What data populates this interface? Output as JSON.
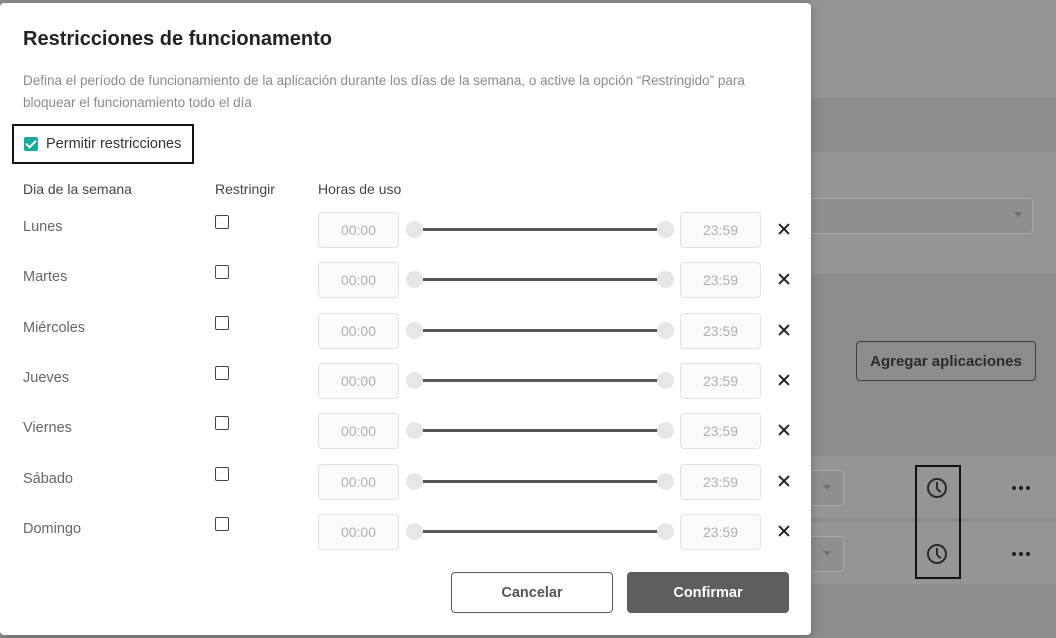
{
  "background": {
    "add_apps_button": "Agregar aplicaciones",
    "rows": [
      {
        "clock_icon": "clock-icon",
        "more_icon": "more-dots-icon"
      },
      {
        "clock_icon": "clock-icon",
        "more_icon": "more-dots-icon"
      }
    ]
  },
  "modal": {
    "title": "Restricciones de funcionamento",
    "description": "Defina el período de funcionamiento de la aplicación durante los días de la semana, o active la opción “Restringido” para bloquear el funcionamiento todo el día",
    "allow_restrictions": {
      "label": "Permitir restricciones",
      "checked": true
    },
    "columns": {
      "day": "Dia de la semana",
      "restrict": "Restringir",
      "hours": "Horas de uso"
    },
    "days": [
      {
        "name": "Lunes",
        "restricted": false,
        "start": "00:00",
        "end": "23:59"
      },
      {
        "name": "Martes",
        "restricted": false,
        "start": "00:00",
        "end": "23:59"
      },
      {
        "name": "Miércoles",
        "restricted": false,
        "start": "00:00",
        "end": "23:59"
      },
      {
        "name": "Jueves",
        "restricted": false,
        "start": "00:00",
        "end": "23:59"
      },
      {
        "name": "Viernes",
        "restricted": false,
        "start": "00:00",
        "end": "23:59"
      },
      {
        "name": "Sábado",
        "restricted": false,
        "start": "00:00",
        "end": "23:59"
      },
      {
        "name": "Domingo",
        "restricted": false,
        "start": "00:00",
        "end": "23:59"
      }
    ],
    "buttons": {
      "cancel": "Cancelar",
      "confirm": "Confirmar"
    }
  },
  "colors": {
    "accent_check": "#1aa89a",
    "confirm_button": "#5e5e5e"
  }
}
